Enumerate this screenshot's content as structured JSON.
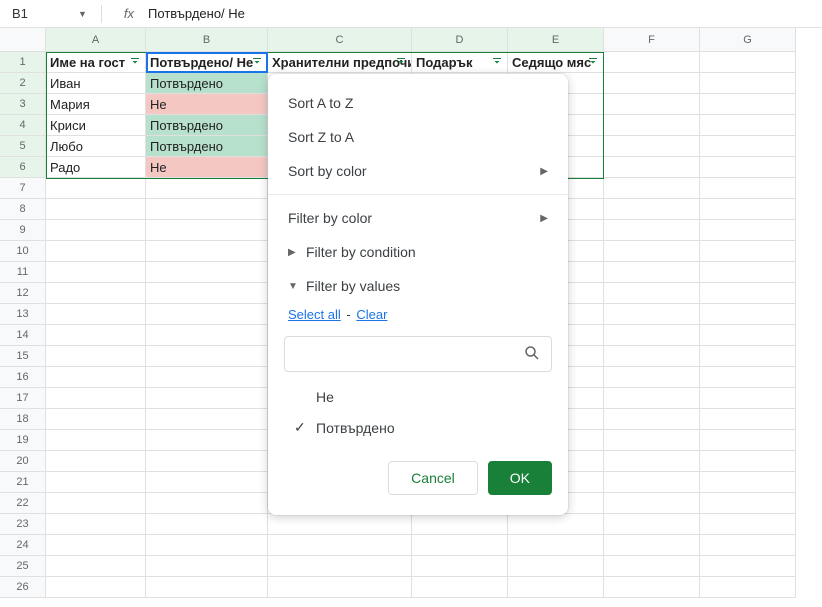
{
  "formula_bar": {
    "name_box": "B1",
    "fx": "fx",
    "content": "Потвърдено/ Не"
  },
  "columns": [
    {
      "letter": "A",
      "cls": "wA",
      "filtered": true
    },
    {
      "letter": "B",
      "cls": "wB",
      "filtered": true
    },
    {
      "letter": "C",
      "cls": "wC",
      "filtered": true
    },
    {
      "letter": "D",
      "cls": "wD",
      "filtered": true
    },
    {
      "letter": "E",
      "cls": "wE",
      "filtered": true
    },
    {
      "letter": "F",
      "cls": "wF",
      "filtered": false
    },
    {
      "letter": "G",
      "cls": "wG",
      "filtered": false
    }
  ],
  "headers": {
    "A": "Име на гост",
    "B": "Потвърдено/ Не",
    "C": "Хранителни предпочита",
    "D": "Подарък",
    "E": "Седящо мяс"
  },
  "rows": [
    {
      "n": 2,
      "A": "Иван",
      "B": "Потвърдено",
      "Bcls": "green"
    },
    {
      "n": 3,
      "A": "Мария",
      "B": "Не",
      "Bcls": "red"
    },
    {
      "n": 4,
      "A": "Криси",
      "B": "Потвърдено",
      "Bcls": "green"
    },
    {
      "n": 5,
      "A": "Любо",
      "B": "Потвърдено",
      "Bcls": "green"
    },
    {
      "n": 6,
      "A": "Радо",
      "B": "Не",
      "Bcls": "red"
    }
  ],
  "popup": {
    "sort_az": "Sort A to Z",
    "sort_za": "Sort Z to A",
    "sort_color": "Sort by color",
    "filter_color": "Filter by color",
    "filter_condition": "Filter by condition",
    "filter_values": "Filter by values",
    "select_all": "Select all",
    "clear": "Clear",
    "search_placeholder": "",
    "values": [
      {
        "label": "Не",
        "checked": false
      },
      {
        "label": "Потвърдено",
        "checked": true
      }
    ],
    "cancel": "Cancel",
    "ok": "OK"
  }
}
